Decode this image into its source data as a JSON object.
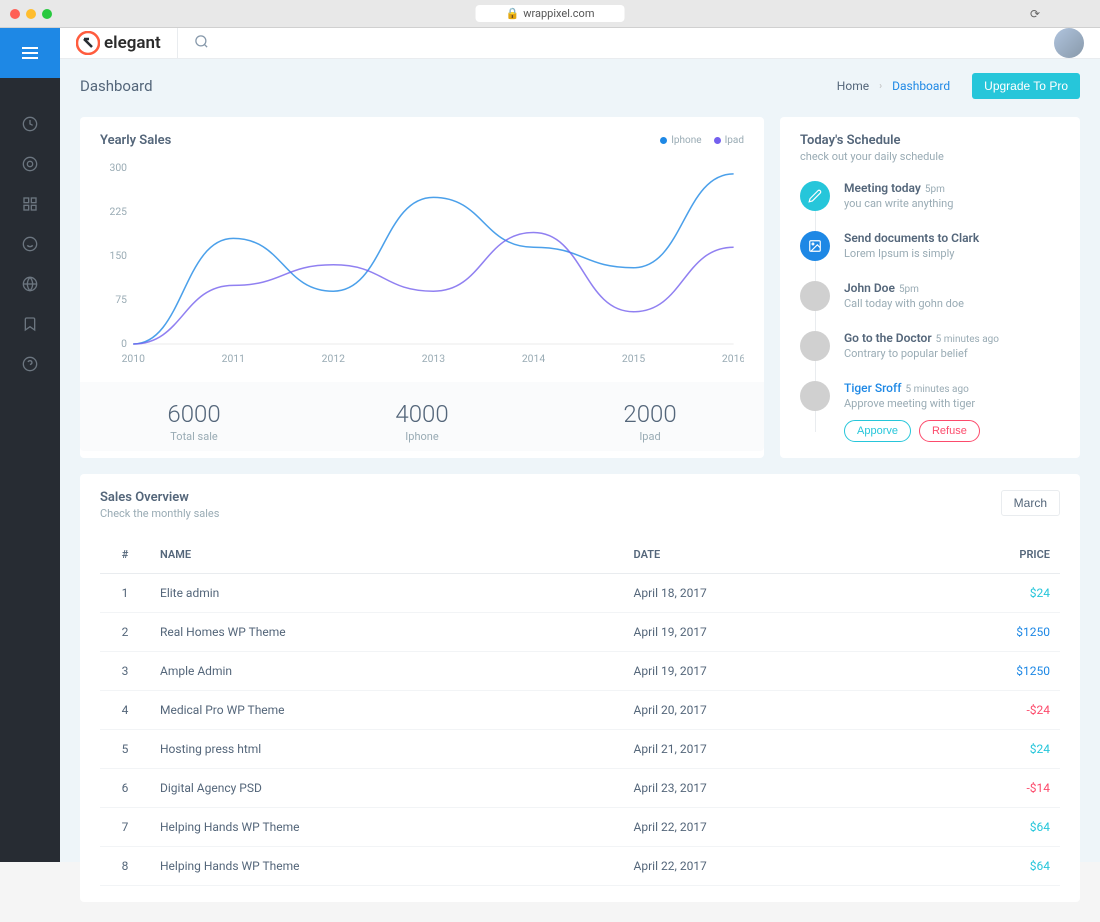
{
  "browser": {
    "url_prefix": "wrappixel.com"
  },
  "brand": {
    "name": "elegant"
  },
  "header": {
    "title": "Dashboard",
    "breadcrumb_home": "Home",
    "breadcrumb_current": "Dashboard",
    "upgrade_label": "Upgrade To Pro"
  },
  "chart_data": {
    "type": "line",
    "title": "Yearly Sales",
    "xlabel": "",
    "ylabel": "",
    "x": [
      2010,
      2011,
      2012,
      2013,
      2014,
      2015,
      2016
    ],
    "ylim": [
      0,
      300
    ],
    "yticks": [
      0,
      75,
      150,
      225,
      300
    ],
    "series": [
      {
        "name": "Iphone",
        "color": "#1e88e5",
        "values": [
          0,
          180,
          90,
          250,
          165,
          130,
          290
        ]
      },
      {
        "name": "Ipad",
        "color": "#7460ee",
        "values": [
          0,
          100,
          135,
          90,
          190,
          55,
          165
        ]
      }
    ],
    "stats": [
      {
        "value": "6000",
        "label": "Total sale"
      },
      {
        "value": "4000",
        "label": "Iphone"
      },
      {
        "value": "2000",
        "label": "Ipad"
      }
    ]
  },
  "schedule": {
    "title": "Today's Schedule",
    "subtitle": "check out your daily schedule",
    "items": [
      {
        "avatar": "pencil",
        "avatar_color": "teal",
        "title": "Meeting today",
        "time": "5pm",
        "desc": "you can write anything",
        "link": false
      },
      {
        "avatar": "image",
        "avatar_color": "blue",
        "title": "Send documents to Clark",
        "time": "",
        "desc": "Lorem Ipsum is simply",
        "link": false
      },
      {
        "avatar": "img",
        "avatar_color": "img",
        "title": "John Doe",
        "time": "5pm",
        "desc": "Call today with gohn doe",
        "link": false
      },
      {
        "avatar": "img",
        "avatar_color": "img",
        "title": "Go to the Doctor",
        "time": "5 minutes ago",
        "desc": "Contrary to popular belief",
        "link": false
      },
      {
        "avatar": "img",
        "avatar_color": "img",
        "title": "Tiger Sroff",
        "time": "5 minutes ago",
        "desc": "Approve meeting with tiger",
        "link": true,
        "actions": true
      }
    ],
    "approve_label": "Apporve",
    "refuse_label": "Refuse"
  },
  "sales": {
    "title": "Sales Overview",
    "subtitle": "Check the monthly sales",
    "month": "March",
    "columns": {
      "num": "#",
      "name": "NAME",
      "date": "DATE",
      "price": "PRICE"
    },
    "rows": [
      {
        "n": "1",
        "name": "Elite admin",
        "date": "April 18, 2017",
        "price": "$24",
        "price_class": "teal"
      },
      {
        "n": "2",
        "name": "Real Homes WP Theme",
        "date": "April 19, 2017",
        "price": "$1250",
        "price_class": "blue"
      },
      {
        "n": "3",
        "name": "Ample Admin",
        "date": "April 19, 2017",
        "price": "$1250",
        "price_class": "blue"
      },
      {
        "n": "4",
        "name": "Medical Pro WP Theme",
        "date": "April 20, 2017",
        "price": "-$24",
        "price_class": "red"
      },
      {
        "n": "5",
        "name": "Hosting press html",
        "date": "April 21, 2017",
        "price": "$24",
        "price_class": "teal"
      },
      {
        "n": "6",
        "name": "Digital Agency PSD",
        "date": "April 23, 2017",
        "price": "-$14",
        "price_class": "red"
      },
      {
        "n": "7",
        "name": "Helping Hands WP Theme",
        "date": "April 22, 2017",
        "price": "$64",
        "price_class": "teal"
      },
      {
        "n": "8",
        "name": "Helping Hands WP Theme",
        "date": "April 22, 2017",
        "price": "$64",
        "price_class": "teal"
      }
    ]
  }
}
